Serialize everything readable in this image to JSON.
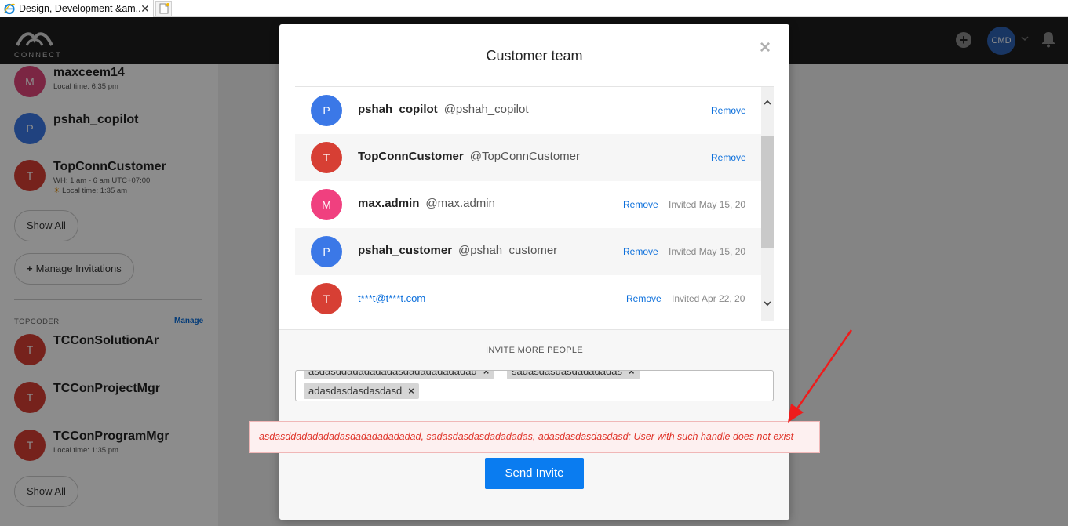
{
  "browser": {
    "tab_title": "Design, Development &am...",
    "tab_close": "✕"
  },
  "header": {
    "logo_text": "CONNECT",
    "avatar_initials": "CMD"
  },
  "sidebar": {
    "members": [
      {
        "initial": "M",
        "name": "maxceem14",
        "sub": "Local time: 6:35 pm",
        "color": "#e0457b"
      },
      {
        "initial": "P",
        "name": "pshah_copilot",
        "sub": "",
        "color": "#3b78e7"
      },
      {
        "initial": "T",
        "name": "TopConnCustomer",
        "sub": "WH: 1 am - 6 am UTC+07:00",
        "sub2": "Local time: 1:35 am",
        "color": "#d73f34"
      }
    ],
    "show_all": "Show All",
    "manage_invitations": "Manage Invitations",
    "section_title": "TOPCODER",
    "section_manage": "Manage",
    "topcoder_members": [
      {
        "initial": "T",
        "name": "TCConSolutionAr",
        "sub": "",
        "color": "#d73f34"
      },
      {
        "initial": "T",
        "name": "TCConProjectMgr",
        "sub": "",
        "color": "#d73f34"
      },
      {
        "initial": "T",
        "name": "TCConProgramMgr",
        "sub": "Local time: 1:35 pm",
        "color": "#d73f34"
      }
    ],
    "show_all_2": "Show All"
  },
  "modal": {
    "title": "Customer team",
    "close": "×",
    "rows": [
      {
        "initial": "P",
        "name": "pshah_copilot",
        "handle": "@pshah_copilot",
        "remove": "Remove",
        "invited": "",
        "color": "#3b78e7"
      },
      {
        "initial": "T",
        "name": "TopConnCustomer",
        "handle": "@TopConnCustomer",
        "remove": "Remove",
        "invited": "",
        "color": "#d73f34"
      },
      {
        "initial": "M",
        "name": "max.admin",
        "handle": "@max.admin",
        "remove": "Remove",
        "invited": "Invited May 15, 20",
        "color": "#f0407f"
      },
      {
        "initial": "P",
        "name": "pshah_customer",
        "handle": "@pshah_customer",
        "remove": "Remove",
        "invited": "Invited May 15, 20",
        "color": "#3b78e7"
      },
      {
        "initial": "T",
        "email": "t***t@t***t.com",
        "remove": "Remove",
        "invited": "Invited Apr 22, 20",
        "color": "#d73f34"
      }
    ],
    "invite_label": "INVITE MORE PEOPLE",
    "tags": [
      "asdasddadadadadasdadadadadadad",
      "sadasdasdasdadadadas",
      "adasdasdasdasdasd"
    ],
    "tag_remove": "×",
    "error": "asdasddadadadadasdadadadadadad, sadasdasdasdadadadas, adasdasdasdasdasd: User with such handle does not exist",
    "send_button": "Send Invite"
  }
}
